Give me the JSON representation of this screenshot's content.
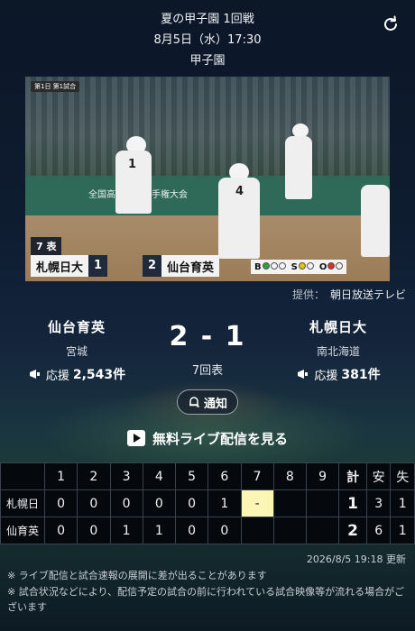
{
  "header": {
    "title": "夏の甲子園 1回戦",
    "datetime": "8月5日（水）17:30",
    "venue": "甲子園"
  },
  "video": {
    "inning_badge": "第1日 第1試合",
    "wall_text": "全国高校野球選手権大会",
    "inning": "7 表",
    "bug_team_a": "札幌日大",
    "bug_score_a": "1",
    "bug_team_b": "仙台育英",
    "bug_score_b": "2",
    "bso_b": "B",
    "bso_s": "S",
    "bso_o": "O",
    "player_numbers": [
      "1",
      "4"
    ]
  },
  "provider": {
    "label": "提供：",
    "name": "朝日放送テレビ"
  },
  "match": {
    "home": {
      "name": "仙台育英",
      "prefecture": "宮城",
      "cheer_label": "応援",
      "cheer_count": "2,543件"
    },
    "away": {
      "name": "札幌日大",
      "prefecture": "南北海道",
      "cheer_label": "応援",
      "cheer_count": "381件"
    },
    "score": "2 - 1",
    "status": "7回表"
  },
  "buttons": {
    "notify": "通知",
    "live": "無料ライブ配信を見る"
  },
  "scoreboard": {
    "headers": [
      "",
      "1",
      "2",
      "3",
      "4",
      "5",
      "6",
      "7",
      "8",
      "9",
      "計",
      "安",
      "失"
    ],
    "rows": [
      {
        "team": "札幌日",
        "innings": [
          "0",
          "0",
          "0",
          "0",
          "0",
          "1",
          "-",
          "",
          ""
        ],
        "total": "1",
        "hits": "3",
        "errors": "1"
      },
      {
        "team": "仙育英",
        "innings": [
          "0",
          "0",
          "1",
          "1",
          "0",
          "0",
          "",
          "",
          ""
        ],
        "total": "2",
        "hits": "6",
        "errors": "1"
      }
    ]
  },
  "updated": "2026/8/5 19:18 更新",
  "notes": [
    "※ ライブ配信と試合速報の展開に差が出ることがあります",
    "※ 試合状況などにより、配信予定の試合の前に行われている試合映像等が流れる場合がございます"
  ],
  "colors": {
    "current_inning": "#fbf5b6",
    "bg_dark": "#0c1728"
  },
  "icons": {
    "refresh": "refresh-icon",
    "cheer": "megaphone-icon",
    "bell": "bell-plus-icon",
    "play": "play-icon"
  }
}
